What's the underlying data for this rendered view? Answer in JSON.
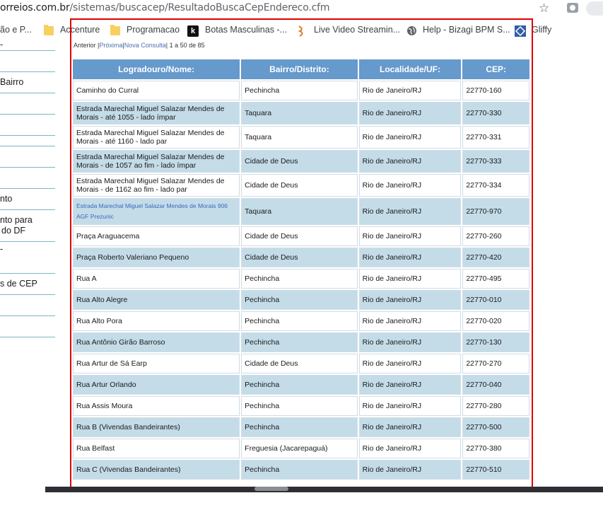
{
  "browser": {
    "url_host": "orreios.com.br",
    "url_path": "/sistemas/buscacep/ResultadoBuscaCepEndereco.cfm",
    "bookmarks": [
      {
        "label": "ão e P...",
        "icon": "partial"
      },
      {
        "label": "Accenture",
        "icon": "folder-icon"
      },
      {
        "label": "Programacao",
        "icon": "folder-icon"
      },
      {
        "label": "Botas Masculinas -...",
        "icon": "k-logo-icon"
      },
      {
        "label": "Live Video Streamin...",
        "icon": "stream-icon"
      },
      {
        "label": "Help - Bizagi BPM S...",
        "icon": "globe-icon"
      },
      {
        "label": "Gliffy",
        "icon": "gliffy-icon"
      }
    ]
  },
  "sidebar": {
    "items": [
      "Bairro",
      "nto",
      "nto para",
      "do DF",
      "s de CEP"
    ]
  },
  "pager": {
    "prev": "Anterior",
    "next": "Próxima",
    "new_search": "Nova Consulta",
    "range": "1 a 50 de 85"
  },
  "table": {
    "headers": [
      "Logradouro/Nome:",
      "Bairro/Distrito:",
      "Localidade/UF:",
      "CEP:"
    ],
    "rows": [
      {
        "logradouro": "Caminho do Curral",
        "bairro": "Pechincha",
        "localidade": "Rio de Janeiro/RJ",
        "cep": "22770-160"
      },
      {
        "logradouro": "Estrada Marechal Miguel Salazar Mendes de Morais - até 1055 - lado ímpar",
        "bairro": "Taquara",
        "localidade": "Rio de Janeiro/RJ",
        "cep": "22770-330"
      },
      {
        "logradouro": "Estrada Marechal Miguel Salazar Mendes de Morais - até 1160 - lado par",
        "bairro": "Taquara",
        "localidade": "Rio de Janeiro/RJ",
        "cep": "22770-331"
      },
      {
        "logradouro": "Estrada Marechal Miguel Salazar Mendes de Morais - de 1057 ao fim - lado ímpar",
        "bairro": "Cidade de Deus",
        "localidade": "Rio de Janeiro/RJ",
        "cep": "22770-333"
      },
      {
        "logradouro": "Estrada Marechal Miguel Salazar Mendes de Morais - de 1162 ao fim - lado par",
        "bairro": "Cidade de Deus",
        "localidade": "Rio de Janeiro/RJ",
        "cep": "22770-334"
      },
      {
        "logradouro": "Estrada Marechal Miguel Salazar Mendes de Morais 906 AGF Prezunic",
        "bairro": "Taquara",
        "localidade": "Rio de Janeiro/RJ",
        "cep": "22770-970"
      },
      {
        "logradouro": "Praça Araguacema",
        "bairro": "Cidade de Deus",
        "localidade": "Rio de Janeiro/RJ",
        "cep": "22770-260"
      },
      {
        "logradouro": "Praça Roberto Valeriano Pequeno",
        "bairro": "Cidade de Deus",
        "localidade": "Rio de Janeiro/RJ",
        "cep": "22770-420"
      },
      {
        "logradouro": "Rua A",
        "bairro": "Pechincha",
        "localidade": "Rio de Janeiro/RJ",
        "cep": "22770-495"
      },
      {
        "logradouro": "Rua Alto Alegre",
        "bairro": "Pechincha",
        "localidade": "Rio de Janeiro/RJ",
        "cep": "22770-010"
      },
      {
        "logradouro": "Rua Alto Pora",
        "bairro": "Pechincha",
        "localidade": "Rio de Janeiro/RJ",
        "cep": "22770-020"
      },
      {
        "logradouro": "Rua Antônio Girão Barroso",
        "bairro": "Pechincha",
        "localidade": "Rio de Janeiro/RJ",
        "cep": "22770-130"
      },
      {
        "logradouro": "Rua Artur de Sá Earp",
        "bairro": "Cidade de Deus",
        "localidade": "Rio de Janeiro/RJ",
        "cep": "22770-270"
      },
      {
        "logradouro": "Rua Artur Orlando",
        "bairro": "Pechincha",
        "localidade": "Rio de Janeiro/RJ",
        "cep": "22770-040"
      },
      {
        "logradouro": "Rua Assis Moura",
        "bairro": "Pechincha",
        "localidade": "Rio de Janeiro/RJ",
        "cep": "22770-280"
      },
      {
        "logradouro": "Rua B (Vivendas Bandeirantes)",
        "bairro": "Pechincha",
        "localidade": "Rio de Janeiro/RJ",
        "cep": "22770-500"
      },
      {
        "logradouro": "Rua Belfast",
        "bairro": "Freguesia (Jacarepaguá)",
        "localidade": "Rio de Janeiro/RJ",
        "cep": "22770-380"
      },
      {
        "logradouro": "Rua C (Vivendas Bandeirantes)",
        "bairro": "Pechincha",
        "localidade": "Rio de Janeiro/RJ",
        "cep": "22770-510"
      }
    ]
  },
  "colors": {
    "header_bg": "#6699cc",
    "row_alt_bg": "#c4dce8",
    "highlight_border": "#e00000",
    "link": "#3a67c0"
  }
}
